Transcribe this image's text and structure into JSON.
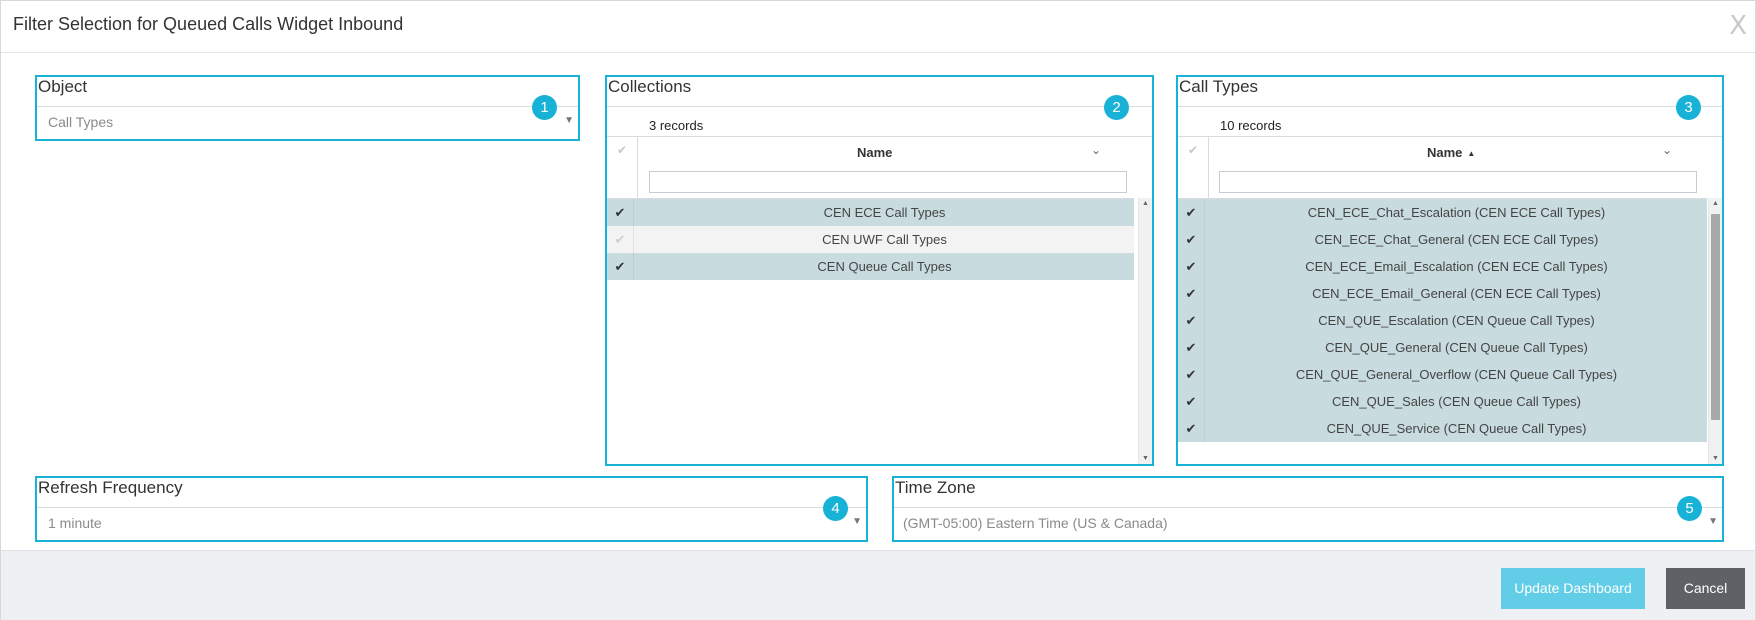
{
  "dialog": {
    "title": "Filter Selection for Queued Calls Widget Inbound",
    "close_label": "X"
  },
  "object": {
    "label": "Object",
    "value": "Call Types",
    "badge": "1"
  },
  "collections": {
    "label": "Collections",
    "badge": "2",
    "records": "3 records",
    "column": "Name",
    "rows": [
      {
        "name": "CEN ECE Call Types",
        "selected": true
      },
      {
        "name": "CEN UWF Call Types",
        "selected": false
      },
      {
        "name": "CEN Queue Call Types",
        "selected": true
      }
    ]
  },
  "call_types": {
    "label": "Call Types",
    "badge": "3",
    "records": "10 records",
    "column": "Name",
    "sort": "ascending",
    "rows": [
      {
        "name": "CEN_ECE_Chat_Escalation (CEN ECE Call Types)",
        "selected": true
      },
      {
        "name": "CEN_ECE_Chat_General (CEN ECE Call Types)",
        "selected": true
      },
      {
        "name": "CEN_ECE_Email_Escalation (CEN ECE Call Types)",
        "selected": true
      },
      {
        "name": "CEN_ECE_Email_General (CEN ECE Call Types)",
        "selected": true
      },
      {
        "name": "CEN_QUE_Escalation (CEN Queue Call Types)",
        "selected": true
      },
      {
        "name": "CEN_QUE_General (CEN Queue Call Types)",
        "selected": true
      },
      {
        "name": "CEN_QUE_General_Overflow (CEN Queue Call Types)",
        "selected": true
      },
      {
        "name": "CEN_QUE_Sales (CEN Queue Call Types)",
        "selected": true
      },
      {
        "name": "CEN_QUE_Service (CEN Queue Call Types)",
        "selected": true
      }
    ]
  },
  "refresh": {
    "label": "Refresh Frequency",
    "value": "1 minute",
    "badge": "4"
  },
  "timezone": {
    "label": "Time Zone",
    "value": "(GMT-05:00) Eastern Time (US & Canada)",
    "badge": "5"
  },
  "footer": {
    "update_label": "Update Dashboard",
    "cancel_label": "Cancel"
  },
  "colors": {
    "accent": "#17b2d6",
    "selected_row": "#c8dbdf",
    "update_button": "#62cde6",
    "cancel_button": "#5e6165"
  },
  "icons": {
    "check": "check-icon",
    "dropdown": "caret-down-icon",
    "column_menu": "chevron-down-icon",
    "sort": "sort-ascending-icon"
  }
}
